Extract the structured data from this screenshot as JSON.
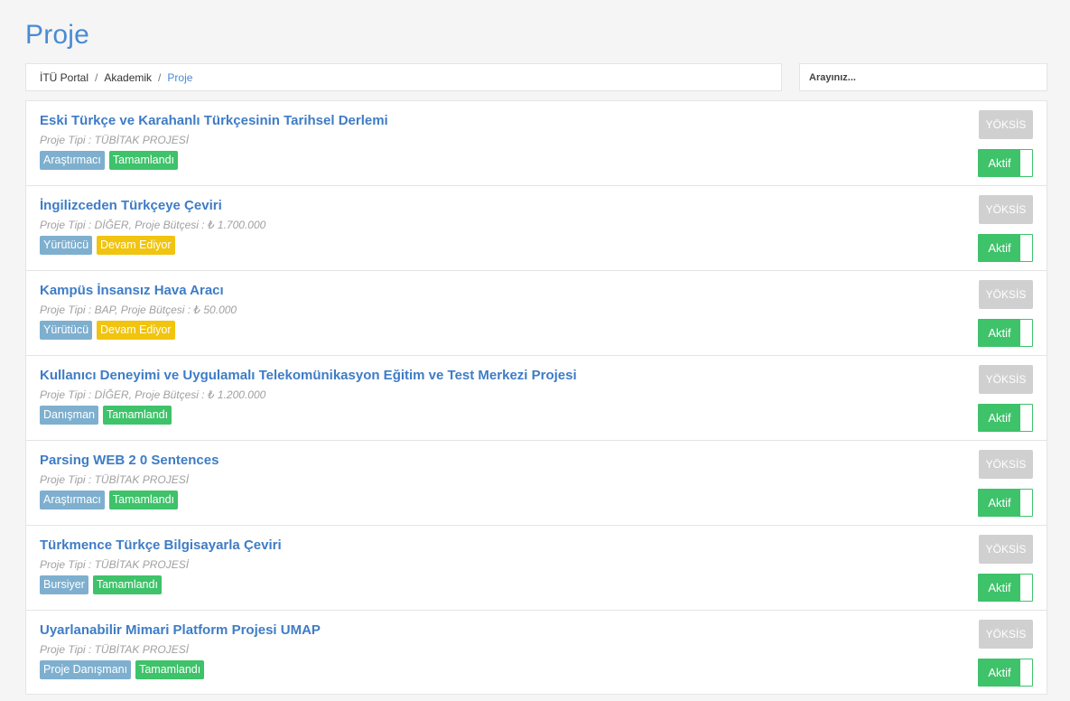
{
  "page": {
    "title": "Proje"
  },
  "breadcrumb": [
    {
      "label": "İTÜ Portal"
    },
    {
      "label": "Akademik"
    },
    {
      "label": "Proje"
    }
  ],
  "search": {
    "placeholder": "Arayınız..."
  },
  "projects": [
    {
      "title": "Eski Türkçe ve Karahanlı Türkçesinin Tarihsel Derlemi",
      "meta": "Proje Tipi : TÜBİTAK PROJESİ",
      "role": "Araştırmacı",
      "status": "Tamamlandı",
      "status_type": "done",
      "yoksis_label": "YÖKSİS",
      "toggle_label": "Aktif"
    },
    {
      "title": "İngilizceden Türkçeye Çeviri",
      "meta": "Proje Tipi : DİĞER, Proje Bütçesi : ₺ 1.700.000",
      "role": "Yürütücü",
      "status": "Devam Ediyor",
      "status_type": "ongoing",
      "yoksis_label": "YÖKSİS",
      "toggle_label": "Aktif"
    },
    {
      "title": "Kampüs İnsansız Hava Aracı",
      "meta": "Proje Tipi : BAP, Proje Bütçesi : ₺ 50.000",
      "role": "Yürütücü",
      "status": "Devam Ediyor",
      "status_type": "ongoing",
      "yoksis_label": "YÖKSİS",
      "toggle_label": "Aktif"
    },
    {
      "title": "Kullanıcı Deneyimi ve Uygulamalı Telekomünikasyon Eğitim ve Test Merkezi Projesi",
      "meta": "Proje Tipi : DİĞER, Proje Bütçesi : ₺ 1.200.000",
      "role": "Danışman",
      "status": "Tamamlandı",
      "status_type": "done",
      "yoksis_label": "YÖKSİS",
      "toggle_label": "Aktif"
    },
    {
      "title": "Parsing WEB 2 0 Sentences",
      "meta": "Proje Tipi : TÜBİTAK PROJESİ",
      "role": "Araştırmacı",
      "status": "Tamamlandı",
      "status_type": "done",
      "yoksis_label": "YÖKSİS",
      "toggle_label": "Aktif"
    },
    {
      "title": "Türkmence Türkçe Bilgisayarla Çeviri",
      "meta": "Proje Tipi : TÜBİTAK PROJESİ",
      "role": "Bursiyer",
      "status": "Tamamlandı",
      "status_type": "done",
      "yoksis_label": "YÖKSİS",
      "toggle_label": "Aktif"
    },
    {
      "title": "Uyarlanabilir Mimari Platform Projesi UMAP",
      "meta": "Proje Tipi : TÜBİTAK PROJESİ",
      "role": "Proje Danışmanı",
      "status": "Tamamlandı",
      "status_type": "done",
      "yoksis_label": "YÖKSİS",
      "toggle_label": "Aktif"
    }
  ],
  "colors": {
    "accent": "#4a8ad4",
    "role_label": "#7eafcf",
    "status_done": "#3ec26a",
    "status_ongoing": "#f1c40f",
    "yoksis_button": "#d0d0d0",
    "toggle_active": "#3ec26a"
  }
}
